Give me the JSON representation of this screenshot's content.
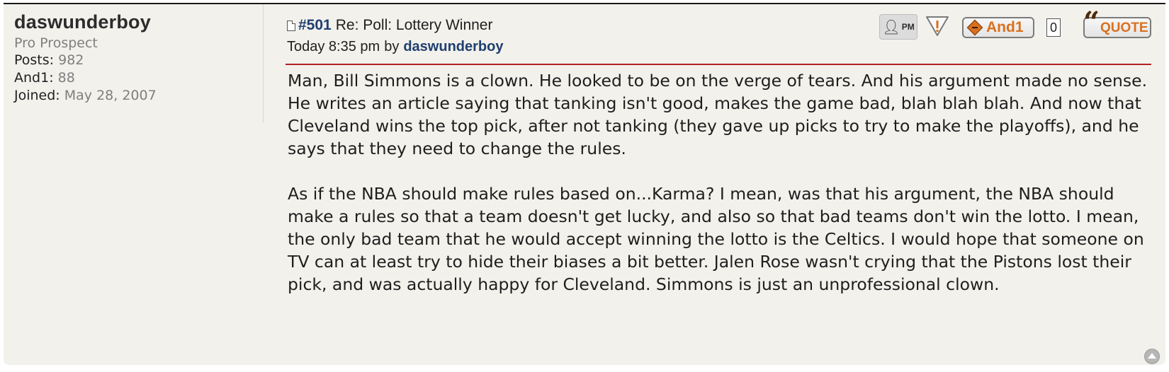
{
  "profile": {
    "username": "daswunderboy",
    "rank": "Pro Prospect",
    "posts_label": "Posts:",
    "posts_value": "982",
    "and1_label": "And1:",
    "and1_value": "88",
    "joined_label": "Joined:",
    "joined_value": "May 28, 2007"
  },
  "post": {
    "number": "#501",
    "title": "Re: Poll: Lottery Winner",
    "time": "Today 8:35 pm",
    "by": "by",
    "author": "daswunderboy",
    "paragraphs": [
      "Man, Bill Simmons is a clown. He looked to be on the verge of tears. And his argument made no sense. He writes an article saying that tanking isn't good, makes the game bad, blah blah blah. And now that Cleveland wins the top pick, after not tanking (they gave up picks to try to make the playoffs), and he says that they need to change the rules.",
      "As if the NBA should make rules based on...Karma? I mean, was that his argument, the NBA should make a rules so that a team doesn't get lucky, and also so that bad teams don't win the lotto. I mean, the only bad team that he would accept winning the lotto is the Celtics. I would hope that someone on TV can at least try to hide their biases a bit better. Jalen Rose wasn't crying that the Pistons lost their pick, and was actually happy for Cleveland. Simmons is just an unprofessional clown."
    ]
  },
  "actions": {
    "pm_label": "PM",
    "and1_label": "And1",
    "and1_count": "0",
    "quote_label": "QUOTE"
  },
  "icons": {
    "doc": "document-icon",
    "pm": "person-icon",
    "report": "warning-icon",
    "and1": "diamond-icon",
    "quote": "quote-mark-icon",
    "top": "arrow-up-icon"
  },
  "colors": {
    "accent_orange": "#d9701e",
    "link_blue": "#1f3f6e",
    "divider_red": "#b22222",
    "post_background": "#f2f1ec"
  }
}
